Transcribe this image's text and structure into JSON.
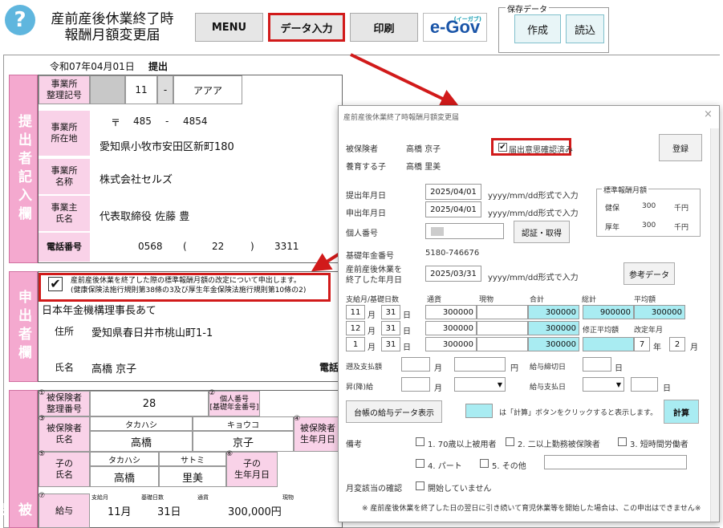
{
  "header": {
    "help_glyph": "?",
    "title_line1": "産前産後休業終了時",
    "title_line2": "報酬月額変更届",
    "menu": "MENU",
    "data_entry": "データ入力",
    "print": "印刷",
    "egov": "e-Gov",
    "egov_small": "(イーガブ)",
    "save_group": "保存データ",
    "create": "作成",
    "load": "読込"
  },
  "form": {
    "date_line": "令和07年04月01日",
    "submit": "提出",
    "sec_submitter": "提出者記入欄",
    "sec_applicant": "申出者欄",
    "sec_insured": "被保",
    "office_code_label": "事業所\n整理記号",
    "office_code_num": "11",
    "office_code_dash": "-",
    "office_code_kana": "アアア",
    "office_addr_label": "事業所\n所在地",
    "postal_mark": "〒",
    "postal1": "485",
    "postal_dash": "-",
    "postal2": "4854",
    "address": "愛知県小牧市安田区新町180",
    "office_name_label": "事業所\n名称",
    "office_name": "株式会社セルズ",
    "owner_label": "事業主\n氏名",
    "owner_name": "代表取締役 佐藤 豊",
    "phone_label": "電話番号",
    "phone1": "0568",
    "phone_paren_open": "(",
    "phone2": "22",
    "phone_paren_close": ")",
    "phone3": "3311",
    "apply_check": "✔",
    "apply_text1": "産前産後休業を終了した際の標準報酬月額の改定について申出します。",
    "apply_text2": "(健康保険法施行規則第38條の3及び厚生年金保険法施行規則第10條の2)",
    "pension_office": "日本年金機構理事長あて",
    "addr_label": "住所",
    "applicant_addr": "愛知県春日井市桃山町1-1",
    "name_label": "氏名",
    "applicant_name": "高橋 京子",
    "phone_cut": "電話",
    "ins_code_label": "被保険者\n整理番号",
    "ins_code_circ": "①",
    "ins_code": "28",
    "mynum_circ": "②",
    "mynum_label": "個人番号\n[基礎年金番号]",
    "ins_name_circ": "③",
    "ins_name_label": "被保険者\n氏名",
    "ins_kana_last": "タカハシ",
    "ins_kana_first": "キョウコ",
    "ins_last": "高橋",
    "ins_first": "京子",
    "ins_dob_circ": "④",
    "ins_dob_label": "被保険者\n生年月日",
    "child_circ": "⑤",
    "child_label": "子の\n氏名",
    "child_kana_last": "タカハシ",
    "child_kana_first": "サトミ",
    "child_last": "高橋",
    "child_first": "里美",
    "child_dob_circ": "⑥",
    "child_dob_label": "子の\n生年月日",
    "pay_circ": "⑦",
    "pay_label": "給与",
    "pay_month_label": "支給月",
    "pay_base_label": "基礎日数",
    "pay_cash_label": "通貨",
    "pay_goods_label": "現物",
    "pay_month": "11月",
    "pay_days": "31日",
    "pay_amount": "300,000円"
  },
  "dialog": {
    "title": "産前産後休業終了時報酬月額変更届",
    "close": "×",
    "insured_label": "被保険者",
    "insured_name": "高橋 京子",
    "child_label": "養育する子",
    "child_name": "高橋 里美",
    "confirm_check": "✔",
    "confirm_label": "届出意思確認済み",
    "register": "登録",
    "submit_date_label": "提出年月日",
    "submit_date": "2025/04/01",
    "date_hint1": "yyyy/mm/dd形式で入力",
    "apply_date_label": "申出年月日",
    "apply_date": "2025/04/01",
    "date_hint2": "yyyy/mm/dd形式で入力",
    "mynum_label": "個人番号",
    "verify_btn": "認証・取得",
    "pension_no_label": "基礎年金番号",
    "pension_no": "5180-746676",
    "end_label1": "産前産後休業を",
    "end_label2": "終了した年月日",
    "end_date": "2025/03/31",
    "date_hint3": "yyyy/mm/dd形式で入力",
    "ref_btn": "参考データ",
    "std_group": "標準報酬月額",
    "std_health_label": "健保",
    "std_health_val": "300",
    "std_health_unit": "千円",
    "std_pension_label": "厚年",
    "std_pension_val": "300",
    "std_pension_unit": "千円",
    "col_paymonth": "支給月/基礎日数",
    "col_cash": "通貨",
    "col_goods": "現物",
    "col_total": "合計",
    "col_sum": "総計",
    "col_avg": "平均額",
    "month_unit": "月",
    "day_unit": "日",
    "rows": [
      {
        "month": "11",
        "days": "31",
        "cash": "300000",
        "goods": "",
        "total": "300000"
      },
      {
        "month": "12",
        "days": "31",
        "cash": "300000",
        "goods": "",
        "total": "300000"
      },
      {
        "month": "1",
        "days": "31",
        "cash": "300000",
        "goods": "",
        "total": "300000"
      }
    ],
    "grand_total": "900000",
    "average": "300000",
    "revised_avg_label": "修正平均額",
    "revised_month_label": "改定年月",
    "revised_month": "7",
    "year_unit": "年",
    "revised_year_month": "2",
    "month_unit2": "月",
    "retro_label": "遡及支払額",
    "retro_month_unit": "月",
    "yen_unit": "円",
    "cutoff_label": "給与締切日",
    "cutoff_unit": "日",
    "raise_label": "昇(降)給",
    "raise_month_unit": "月",
    "payday_label": "給与支払日",
    "payday_unit": "日",
    "ledger_btn": "台帳の給与データ表示",
    "calc_hint": "は「計算」ボタンをクリックすると表示します。",
    "calc_btn": "計算",
    "remarks_label": "備考",
    "rem1": "1. 70歳以上被用者",
    "rem2": "2. 二以上勤務被保険者",
    "rem3": "3. 短時間労働者",
    "rem4": "4. パート",
    "rem5": "5. その他",
    "monthly_label": "月変該当の確認",
    "monthly_opt": "開始していません",
    "footnote": "※ 産前産後休業を終了した日の翌日に引き続いて育児休業等を開始した場合は、この申出はできません※"
  },
  "accent": {
    "red": "#d11a1a",
    "pink": "#f4a9cf",
    "cyan": "#a9ecf2",
    "teal": "#1aa0b5"
  }
}
